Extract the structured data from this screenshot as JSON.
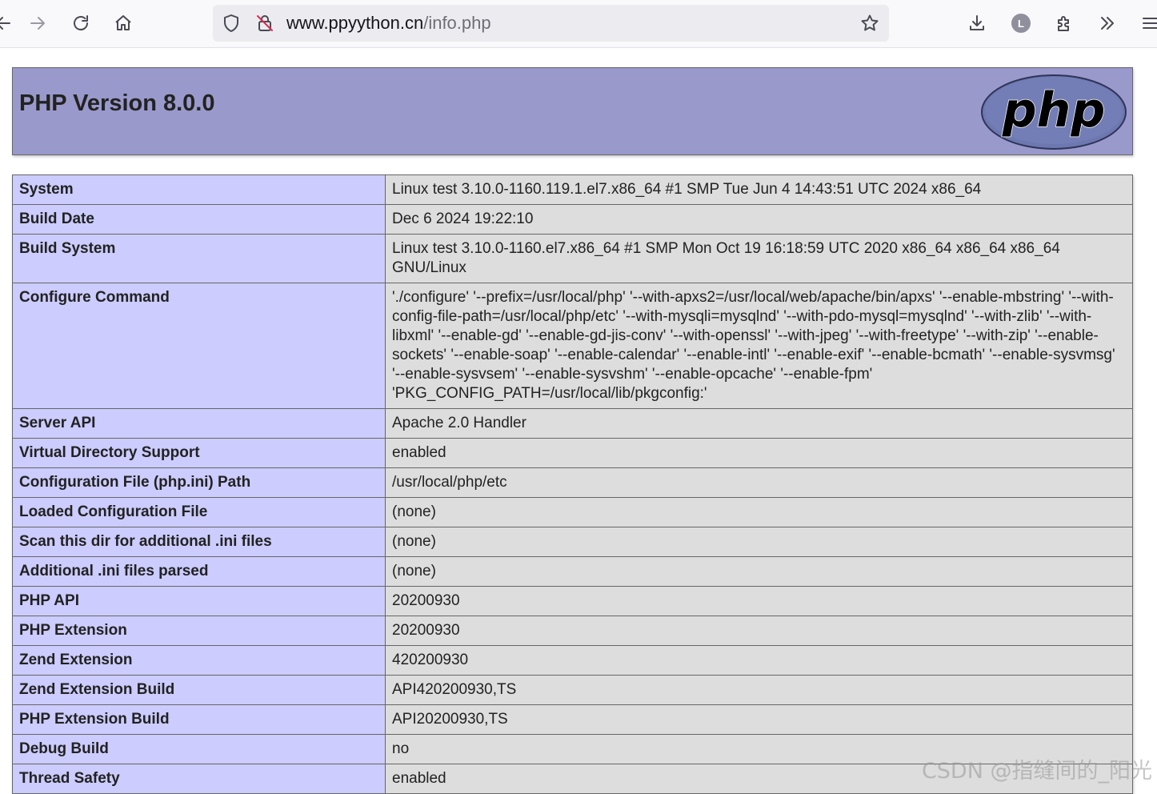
{
  "browser": {
    "url_domain": "www.ppyython.cn",
    "url_path": "/info.php",
    "profile_initial": "L",
    "icons": [
      "back-icon",
      "forward-icon",
      "reload-icon",
      "home-icon",
      "shield-icon",
      "insecure-lock-icon",
      "bookmark-star-icon",
      "download-icon",
      "account-icon",
      "extensions-icon",
      "overflow-chevrons-icon",
      "menu-icon"
    ]
  },
  "php": {
    "title": "PHP Version 8.0.0",
    "logo_text": "php",
    "rows": [
      {
        "key": "System",
        "value": "Linux test 3.10.0-1160.119.1.el7.x86_64 #1 SMP Tue Jun 4 14:43:51 UTC 2024 x86_64"
      },
      {
        "key": "Build Date",
        "value": "Dec 6 2024 19:22:10"
      },
      {
        "key": "Build System",
        "value": "Linux test 3.10.0-1160.el7.x86_64 #1 SMP Mon Oct 19 16:18:59 UTC 2020 x86_64 x86_64 x86_64 GNU/Linux"
      },
      {
        "key": "Configure Command",
        "value": "'./configure' '--prefix=/usr/local/php' '--with-apxs2=/usr/local/web/apache/bin/apxs' '--enable-mbstring' '--with-config-file-path=/usr/local/php/etc' '--with-mysqli=mysqlnd' '--with-pdo-mysql=mysqlnd' '--with-zlib' '--with-libxml' '--enable-gd' '--enable-gd-jis-conv' '--with-openssl' '--with-jpeg' '--with-freetype' '--with-zip' '--enable-sockets' '--enable-soap' '--enable-calendar' '--enable-intl' '--enable-exif' '--enable-bcmath' '--enable-sysvmsg' '--enable-sysvsem' '--enable-sysvshm' '--enable-opcache' '--enable-fpm' 'PKG_CONFIG_PATH=/usr/local/lib/pkgconfig:'"
      },
      {
        "key": "Server API",
        "value": "Apache 2.0 Handler"
      },
      {
        "key": "Virtual Directory Support",
        "value": "enabled"
      },
      {
        "key": "Configuration File (php.ini) Path",
        "value": "/usr/local/php/etc"
      },
      {
        "key": "Loaded Configuration File",
        "value": "(none)"
      },
      {
        "key": "Scan this dir for additional .ini files",
        "value": "(none)"
      },
      {
        "key": "Additional .ini files parsed",
        "value": "(none)"
      },
      {
        "key": "PHP API",
        "value": "20200930"
      },
      {
        "key": "PHP Extension",
        "value": "20200930"
      },
      {
        "key": "Zend Extension",
        "value": "420200930"
      },
      {
        "key": "Zend Extension Build",
        "value": "API420200930,TS"
      },
      {
        "key": "PHP Extension Build",
        "value": "API20200930,TS"
      },
      {
        "key": "Debug Build",
        "value": "no"
      },
      {
        "key": "Thread Safety",
        "value": "enabled"
      }
    ]
  },
  "watermark": "CSDN @指缝间的_阳光",
  "colors": {
    "header_bg": "#9999cc",
    "key_cell_bg": "#ccccff",
    "value_cell_bg": "#dddddd",
    "logo_bg": "#6c78af"
  }
}
